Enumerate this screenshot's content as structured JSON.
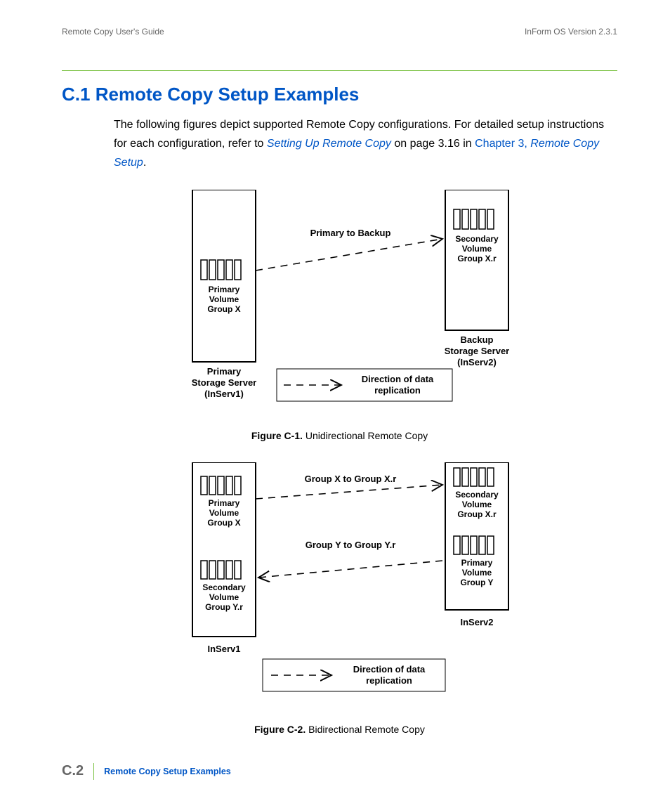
{
  "header": {
    "left": "Remote Copy User's Guide",
    "right": "InForm OS Version 2.3.1"
  },
  "section": {
    "number": "C.1",
    "title": "Remote Copy Setup Examples",
    "para_a": "The following figures depict supported Remote Copy configurations. For detailed setup instructions for each configuration, refer to ",
    "link1": "Setting Up Remote Copy",
    "para_b": " on page 3.16 in ",
    "link2": "Chapter 3, ",
    "link2_italic": "Remote Copy Setup",
    "para_c": "."
  },
  "fig1": {
    "caption_label": "Figure C-1.",
    "caption_text": "Unidirectional Remote Copy",
    "arrow_label": "Primary to Backup",
    "primary_vol_l1": "Primary",
    "primary_vol_l2": "Volume",
    "primary_vol_l3": "Group X",
    "secondary_vol_l1": "Secondary",
    "secondary_vol_l2": "Volume",
    "secondary_vol_l3": "Group X.r",
    "primary_server_l1": "Primary",
    "primary_server_l2": "Storage Server",
    "primary_server_l3": "(InServ1)",
    "backup_server_l1": "Backup",
    "backup_server_l2": "Storage Server",
    "backup_server_l3": "(InServ2)",
    "legend_l1": "Direction of data",
    "legend_l2": "replication"
  },
  "fig2": {
    "caption_label": "Figure C-2.",
    "caption_text": "Bidirectional Remote Copy",
    "arrowX_label": "Group X to Group X.r",
    "arrowY_label": "Group Y to Group Y.r",
    "left_primary_l1": "Primary",
    "left_primary_l2": "Volume",
    "left_primary_l3": "Group X",
    "left_secondary_l1": "Secondary",
    "left_secondary_l2": "Volume",
    "left_secondary_l3": "Group Y.r",
    "right_secondary_l1": "Secondary",
    "right_secondary_l2": "Volume",
    "right_secondary_l3": "Group X.r",
    "right_primary_l1": "Primary",
    "right_primary_l2": "Volume",
    "right_primary_l3": "Group Y",
    "left_server": "InServ1",
    "right_server": "InServ2",
    "legend_l1": "Direction of data",
    "legend_l2": "replication"
  },
  "footer": {
    "page": "C.2",
    "title": "Remote Copy Setup Examples"
  }
}
